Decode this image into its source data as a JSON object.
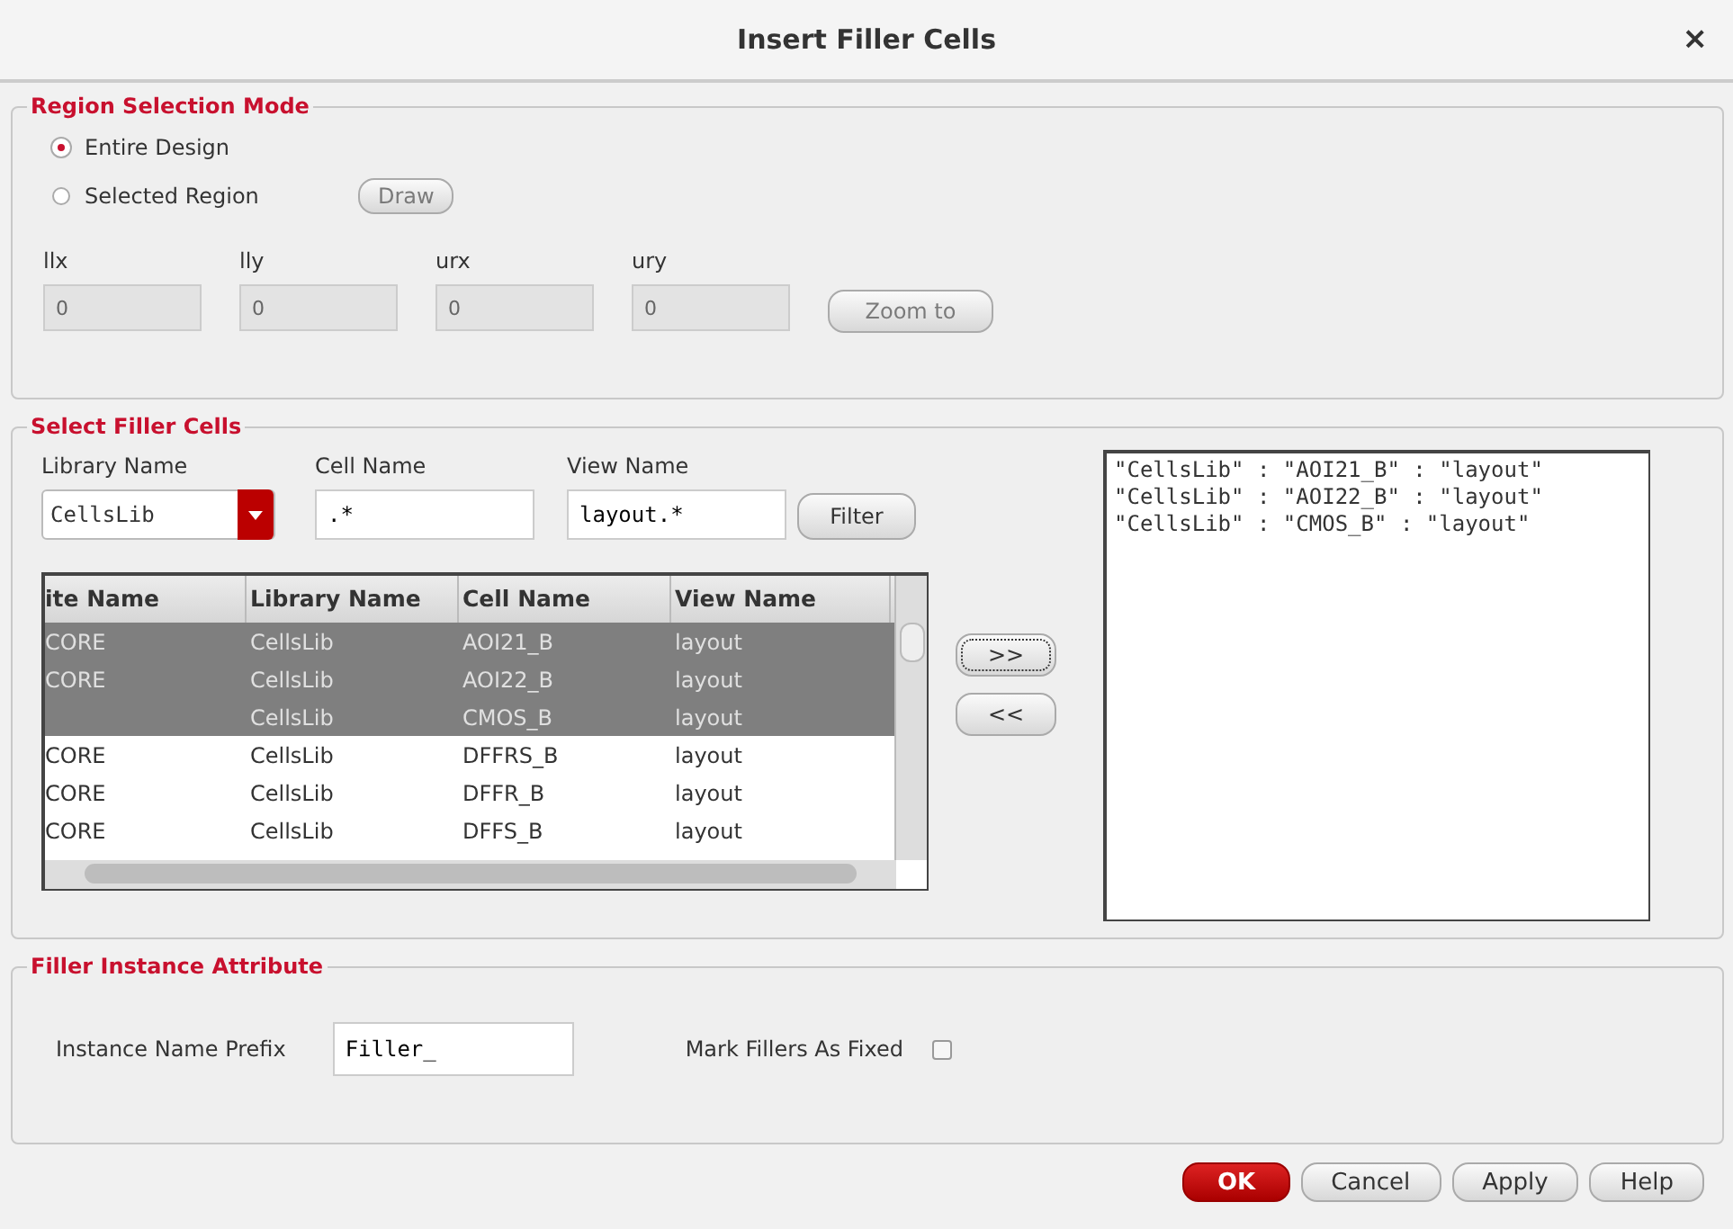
{
  "window": {
    "title": "Insert Filler Cells",
    "close": "×"
  },
  "region_selection": {
    "legend": "Region Selection Mode",
    "modes": [
      {
        "label": "Entire Design",
        "selected": true
      },
      {
        "label": "Selected Region",
        "selected": false
      }
    ],
    "draw_button": {
      "label": "Draw",
      "disabled": true
    },
    "coords": [
      {
        "label": "llx",
        "value": "0"
      },
      {
        "label": "lly",
        "value": "0"
      },
      {
        "label": "urx",
        "value": "0"
      },
      {
        "label": "ury",
        "value": "0"
      }
    ],
    "zoom_button": {
      "label": "Zoom to",
      "disabled": true
    }
  },
  "filler_cells": {
    "legend": "Select Filler Cells",
    "library": {
      "label": "Library Name",
      "value": "CellsLib"
    },
    "cell": {
      "label": "Cell Name",
      "value": ".*"
    },
    "view": {
      "label": "View Name",
      "value": "layout.*"
    },
    "filter_button": "Filter",
    "table": {
      "columns": [
        "ite Name",
        "Library Name",
        "Cell Name",
        "View Name"
      ],
      "rows": [
        {
          "cells": [
            "CORE",
            "CellsLib",
            "AOI21_B",
            "layout"
          ],
          "selected": true
        },
        {
          "cells": [
            "CORE",
            "CellsLib",
            "AOI22_B",
            "layout"
          ],
          "selected": true
        },
        {
          "cells": [
            "",
            "CellsLib",
            "CMOS_B",
            "layout"
          ],
          "selected": true
        },
        {
          "cells": [
            "CORE",
            "CellsLib",
            "DFFRS_B",
            "layout"
          ],
          "selected": false
        },
        {
          "cells": [
            "CORE",
            "CellsLib",
            "DFFR_B",
            "layout"
          ],
          "selected": false
        },
        {
          "cells": [
            "CORE",
            "CellsLib",
            "DFFS_B",
            "layout"
          ],
          "selected": false
        }
      ]
    },
    "add_button": ">>",
    "remove_button": "<<",
    "chosen": [
      "\"CellsLib\" : \"AOI21_B\" : \"layout\"",
      "\"CellsLib\" : \"AOI22_B\" : \"layout\"",
      "\"CellsLib\" : \"CMOS_B\" : \"layout\""
    ]
  },
  "instance_attribute": {
    "legend": "Filler Instance Attribute",
    "prefix": {
      "label": "Instance Name Prefix",
      "value": "Filler_"
    },
    "fixed": {
      "label": "Mark Fillers As Fixed",
      "checked": false
    }
  },
  "buttons": [
    {
      "label": "OK",
      "kind": "primary"
    },
    {
      "label": "Cancel",
      "kind": "normal"
    },
    {
      "label": "Apply",
      "kind": "normal"
    },
    {
      "label": "Help",
      "kind": "normal"
    }
  ]
}
